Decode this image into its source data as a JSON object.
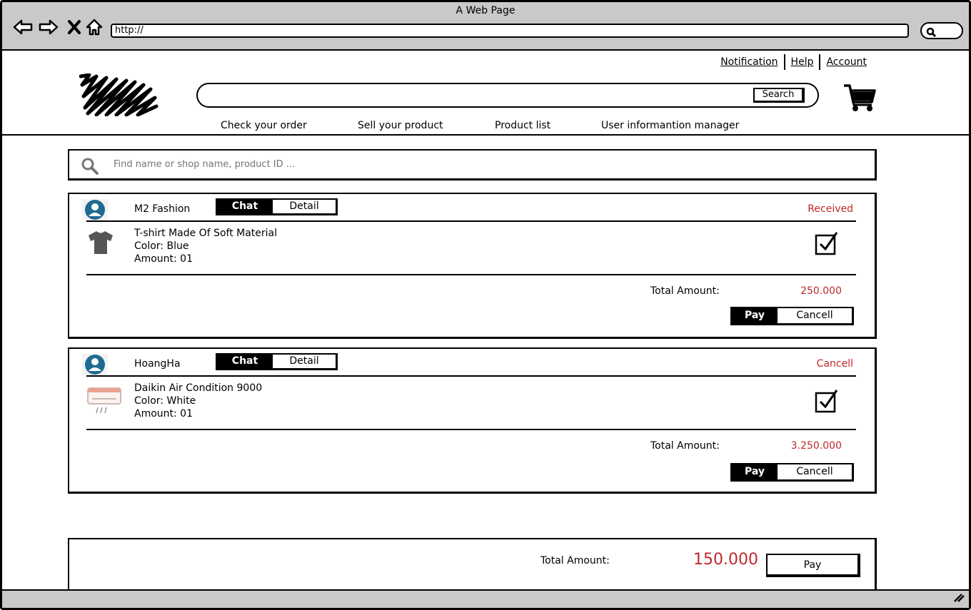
{
  "window": {
    "title": "A Web Page",
    "url": "http://"
  },
  "header": {
    "links": [
      "Notification",
      "Help",
      "Account"
    ],
    "search_button": "Search",
    "menu": [
      "Check your order",
      "Sell your product",
      "Product list",
      "User informantion manager"
    ]
  },
  "filter": {
    "placeholder": "Find name or shop name, product ID ..."
  },
  "orders": [
    {
      "shop": "M2 Fashion",
      "chat_label": "Chat",
      "detail_label": "Detail",
      "status": "Received",
      "product": {
        "name": "T-shirt Made Of Soft Material",
        "color": "Color: Blue",
        "amount": "Amount: 01",
        "icon": "tshirt-icon"
      },
      "checked": true,
      "total_label": "Total Amount:",
      "total": "250.000",
      "pay_label": "Pay",
      "cancel_label": "Cancell"
    },
    {
      "shop": "HoangHa",
      "chat_label": "Chat",
      "detail_label": "Detail",
      "status": "Cancell",
      "product": {
        "name": "Daikin Air Condition 9000",
        "color": "Color: White",
        "amount": "Amount: 01",
        "icon": "air-conditioner-icon"
      },
      "checked": true,
      "total_label": "Total Amount:",
      "total": "3.250.000",
      "pay_label": "Pay",
      "cancel_label": "Cancell"
    }
  ],
  "summary": {
    "label": "Total Amount:",
    "total": "150.000",
    "pay_label": "Pay"
  },
  "colors": {
    "accent_red": "#c0282d",
    "chrome_gray": "#c9c9c9",
    "avatar_blue": "#1f6a92"
  }
}
